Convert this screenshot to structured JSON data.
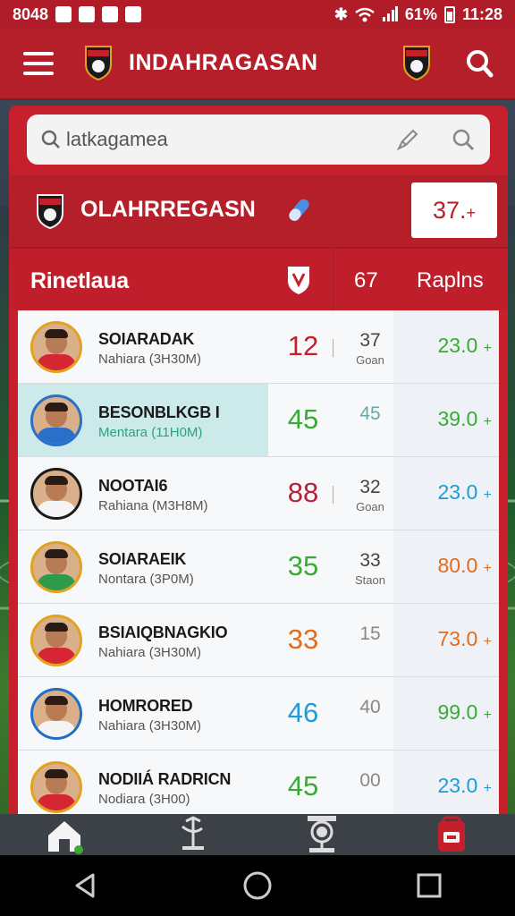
{
  "status_bar": {
    "left_text": "8048",
    "battery": "61%",
    "time": "11:28"
  },
  "app_bar": {
    "title": "INDAHRAGASAN",
    "menu_icon": "hamburger-icon",
    "search_icon": "search-icon"
  },
  "search": {
    "value": "latkagamea",
    "placeholder": "latkagamea"
  },
  "team": {
    "name": "OLAHRREGASN",
    "score": "37.",
    "score_suffix": "+"
  },
  "columns": {
    "name": "Rinetlaua",
    "number": "67",
    "rank": "Raplns"
  },
  "players": [
    {
      "name": "SOIARADAK",
      "sub": "Nahiara (3H30M)",
      "score": "12",
      "score_color": "#c61f2c",
      "num": "37",
      "num_sub": "Goan",
      "value": "23.0",
      "value_suffix": "+",
      "value_color": "#3aaa35",
      "avatar_shirt": "#d62632",
      "avatar_ring": "#e2a21e"
    },
    {
      "name": "BESONBLKGB I",
      "sub": "Mentara (11H0M)",
      "score": "45",
      "score_color": "#3aaa35",
      "num": "45",
      "num_sub": "",
      "value": "39.0",
      "value_suffix": "+",
      "value_color": "#3aaa35",
      "avatar_shirt": "#2a6fc9",
      "avatar_ring": "#2a6fc9"
    },
    {
      "name": "NOOTAI6",
      "sub": "Rahiana (M3H8M)",
      "score": "88",
      "score_color": "#b5213a",
      "num": "32",
      "num_sub": "Goan",
      "value": "23.0",
      "value_suffix": "+",
      "value_color": "#1f9bd6",
      "avatar_shirt": "#f4f4f4",
      "avatar_ring": "#1a1a1a"
    },
    {
      "name": "SOIARAEIK",
      "sub": "Nontara (3P0M)",
      "score": "35",
      "score_color": "#3aaa35",
      "num": "33",
      "num_sub": "Staon",
      "value": "80.0",
      "value_suffix": "+",
      "value_color": "#e36b1c",
      "avatar_shirt": "#2e9a4a",
      "avatar_ring": "#e2a21e"
    },
    {
      "name": "BSIAIQBNAGKIO",
      "sub": "Nahiara (3H30M)",
      "score": "33",
      "score_color": "#e36b1c",
      "num": "15",
      "num_sub": "",
      "value": "73.0",
      "value_suffix": "+",
      "value_color": "#e36b1c",
      "avatar_shirt": "#d62632",
      "avatar_ring": "#e2a21e"
    },
    {
      "name": "HOMRORED",
      "sub": "Nahiara (3H30M)",
      "score": "46",
      "score_color": "#1f9bd6",
      "num": "40",
      "num_sub": "",
      "value": "99.0",
      "value_suffix": "+",
      "value_color": "#3aaa35",
      "avatar_shirt": "#f4f4f4",
      "avatar_ring": "#1f6fc9"
    },
    {
      "name": "NODIIÁ RADRICN",
      "sub": "Nodiara (3H00)",
      "score": "45",
      "score_color": "#3aaa35",
      "num": "00",
      "num_sub": "",
      "value": "23.0",
      "value_suffix": "+",
      "value_color": "#1f9bd6",
      "avatar_shirt": "#d62632",
      "avatar_ring": "#e2a21e"
    }
  ],
  "bottom_nav": [
    {
      "icon": "home-icon"
    },
    {
      "icon": "scale-icon"
    },
    {
      "icon": "trophy-icon"
    },
    {
      "icon": "calendar-icon"
    }
  ],
  "colors": {
    "brand": "#b51f2a",
    "panel": "#c6202c"
  }
}
